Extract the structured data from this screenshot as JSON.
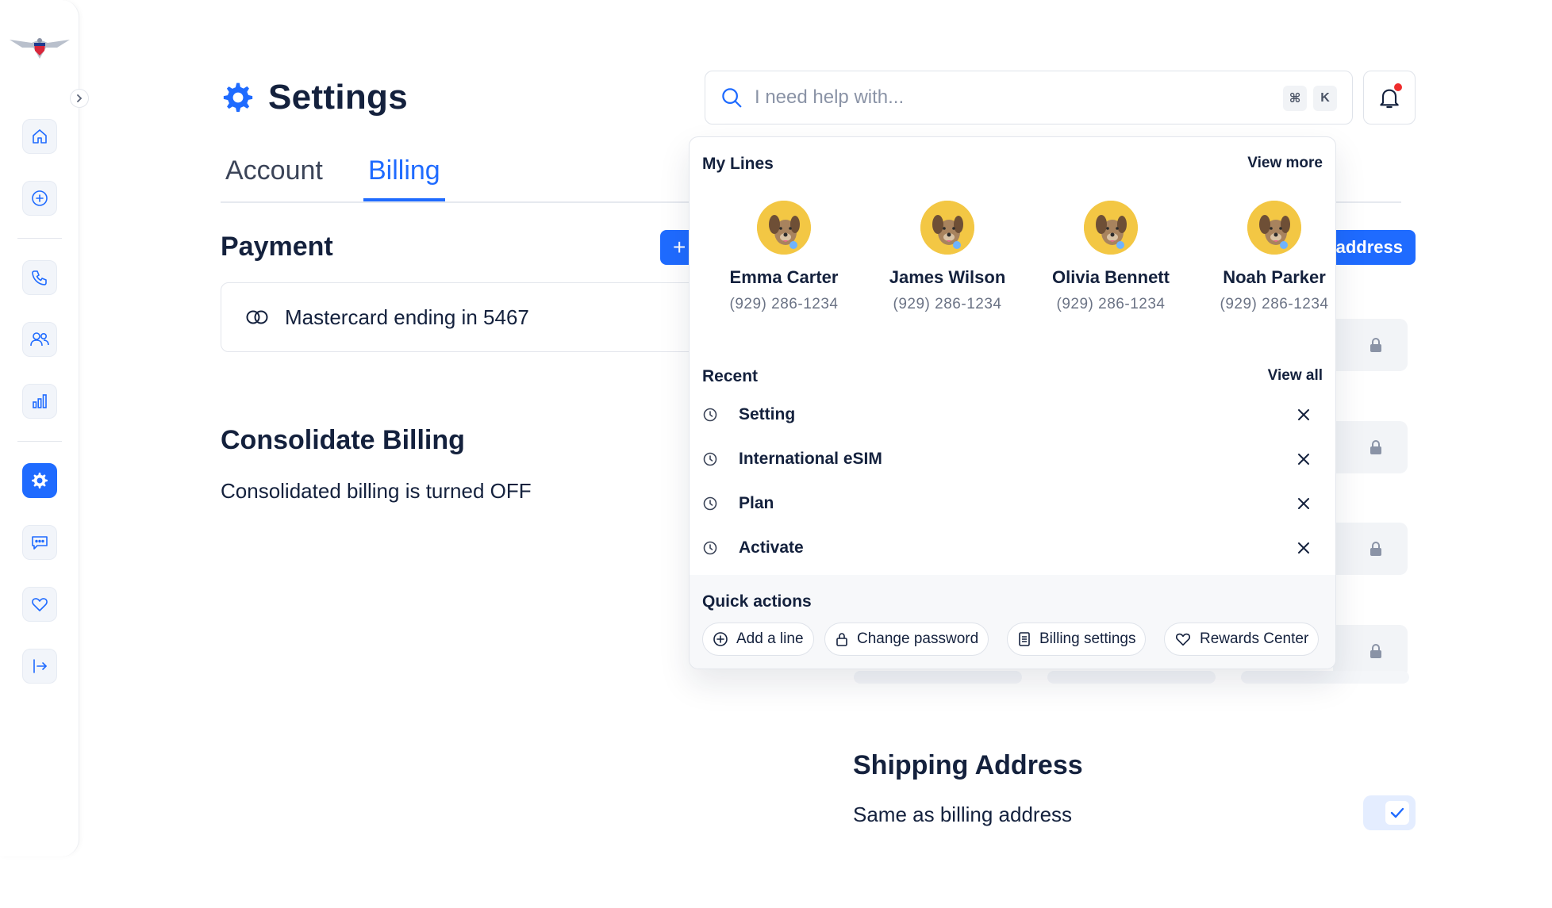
{
  "sidebar": {
    "logo_icon": "eagle-logo-icon",
    "collapse_icon": "chevron-right-icon",
    "nav_items": [
      {
        "name": "home",
        "icon": "home-icon"
      },
      {
        "name": "add",
        "icon": "plus-circle-icon"
      },
      {
        "name": "calls",
        "icon": "phone-icon"
      },
      {
        "name": "users",
        "icon": "users-icon"
      },
      {
        "name": "usage",
        "icon": "bar-chart-icon"
      },
      {
        "name": "settings",
        "icon": "gear-icon",
        "active": true
      },
      {
        "name": "messages",
        "icon": "chat-icon"
      },
      {
        "name": "rewards",
        "icon": "heart-icon"
      },
      {
        "name": "logout",
        "icon": "logout-icon"
      }
    ]
  },
  "header": {
    "title": "Settings",
    "search": {
      "placeholder": "I need help with...",
      "shortcut_cmd": "⌘",
      "shortcut_key": "K"
    }
  },
  "tabs": [
    {
      "label": "Account",
      "active": false
    },
    {
      "label": "Billing",
      "active": true
    }
  ],
  "payment": {
    "title": "Payment",
    "add_label": "+",
    "card_text": "Mastercard ending in 5467"
  },
  "consolidate": {
    "title": "Consolidate Billing",
    "text": "Consolidated billing is turned OFF"
  },
  "billing_address": {
    "button_label": "address"
  },
  "shipping": {
    "title": "Shipping Address",
    "text": "Same as billing address",
    "same_as_billing": true
  },
  "popup": {
    "my_lines_title": "My Lines",
    "view_more": "View more",
    "lines": [
      {
        "name": "Emma Carter",
        "phone": "(929) 286-1234"
      },
      {
        "name": "James Wilson",
        "phone": "(929) 286-1234"
      },
      {
        "name": "Olivia Bennett",
        "phone": "(929) 286-1234"
      },
      {
        "name": "Noah Parker",
        "phone": "(929) 286-1234"
      }
    ],
    "recent_title": "Recent",
    "view_all": "View all",
    "recent": [
      {
        "label": "Setting"
      },
      {
        "label": "International eSIM"
      },
      {
        "label": "Plan"
      },
      {
        "label": "Activate"
      }
    ],
    "quick_title": "Quick actions",
    "quick_actions": [
      {
        "label": "Add a line",
        "icon": "plus-circle-icon"
      },
      {
        "label": "Change password",
        "icon": "lock-icon"
      },
      {
        "label": "Billing settings",
        "icon": "document-icon"
      },
      {
        "label": "Rewards Center",
        "icon": "heart-icon"
      }
    ]
  },
  "colors": {
    "accent": "#1f6bff",
    "text": "#14213d",
    "muted": "#6b7385",
    "notification": "#ef2d2d"
  }
}
